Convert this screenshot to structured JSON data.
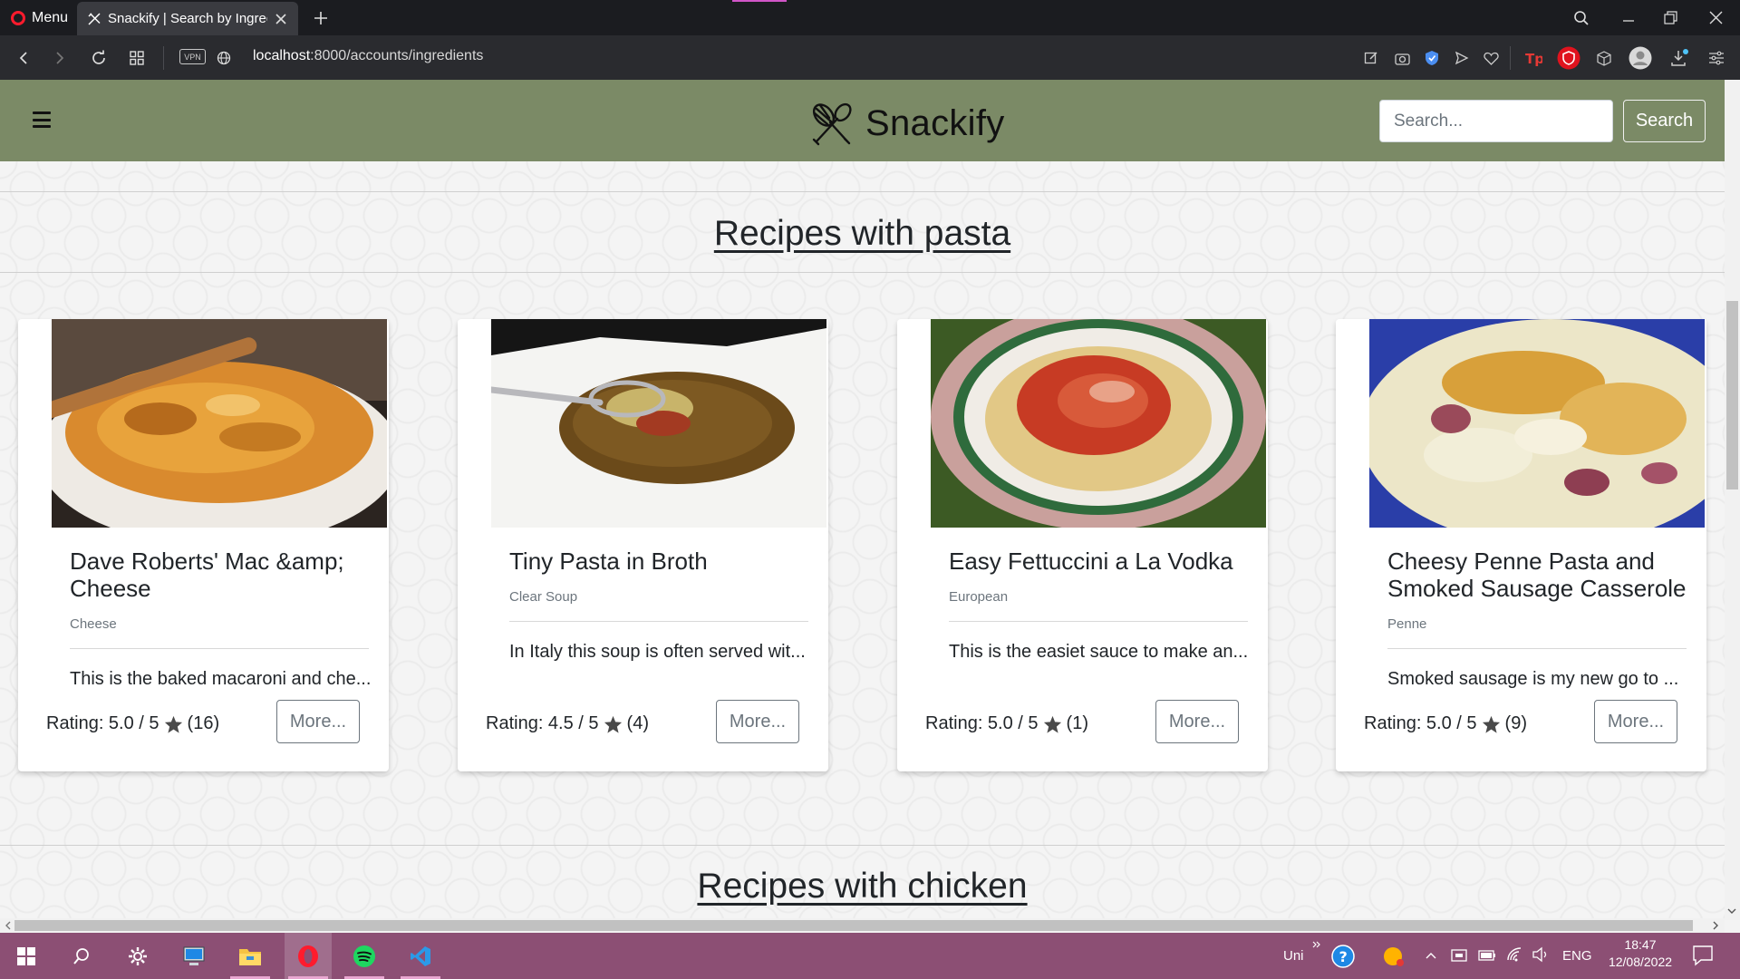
{
  "browser": {
    "menu_label": "Menu",
    "tab_title": "Snackify | Search by Ingredients",
    "url_host": "localhost",
    "url_path": ":8000/accounts/ingredients"
  },
  "navbar": {
    "brand": "Snackify",
    "search_placeholder": "Search...",
    "search_button": "Search"
  },
  "sections": [
    {
      "title": "Recipes with pasta"
    },
    {
      "title": "Recipes with chicken"
    }
  ],
  "recipes": [
    {
      "title": "Dave Roberts' Mac &amp; Cheese",
      "tag": "Cheese",
      "description": "This is the baked macaroni and che...",
      "rating": "Rating: 5.0 / 5",
      "count": "(16)",
      "more": "More..."
    },
    {
      "title": "Tiny Pasta in Broth",
      "tag": "Clear Soup",
      "description": "In Italy this soup is often served wit...",
      "rating": "Rating: 4.5 / 5",
      "count": "(4)",
      "more": "More..."
    },
    {
      "title": "Easy Fettuccini a La Vodka",
      "tag": "European",
      "description": "This is the easiet sauce to make an...",
      "rating": "Rating: 5.0 / 5",
      "count": "(1)",
      "more": "More..."
    },
    {
      "title": "Cheesy Penne Pasta and Smoked Sausage Casserole",
      "tag": "Penne",
      "description": "Smoked sausage is my new go to ...",
      "rating": "Rating: 5.0 / 5",
      "count": "(9)",
      "more": "More..."
    }
  ],
  "taskbar": {
    "tray_label": "Uni",
    "language": "ENG",
    "time": "18:47",
    "date": "12/08/2022"
  },
  "colors": {
    "navbar_bg": "#7b8a66",
    "taskbar_bg": "#8c4f74",
    "tab_bar_bg": "#1b1c20"
  }
}
